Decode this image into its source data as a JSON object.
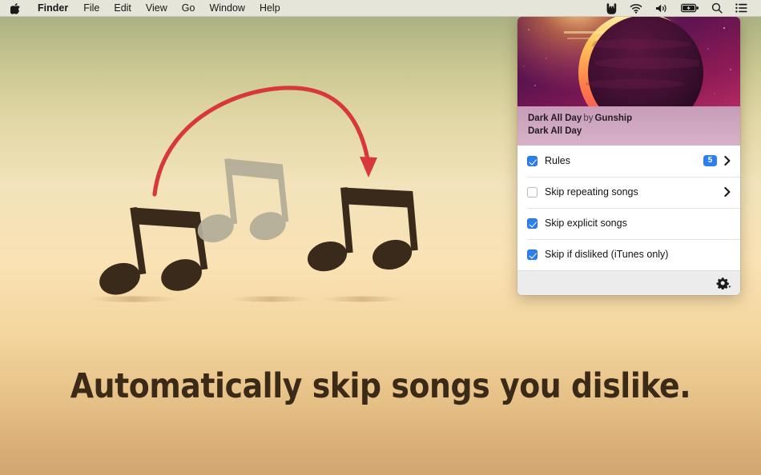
{
  "menubar": {
    "apple_icon": "apple-logo-icon",
    "items": [
      {
        "label": "Finder",
        "bold": true
      },
      {
        "label": "File",
        "bold": false
      },
      {
        "label": "Edit",
        "bold": false
      },
      {
        "label": "View",
        "bold": false
      },
      {
        "label": "Go",
        "bold": false
      },
      {
        "label": "Window",
        "bold": false
      },
      {
        "label": "Help",
        "bold": false
      }
    ],
    "status_icons": [
      {
        "name": "hand-horns-icon"
      },
      {
        "name": "wifi-icon"
      },
      {
        "name": "volume-icon"
      },
      {
        "name": "battery-charging-icon"
      },
      {
        "name": "search-icon"
      },
      {
        "name": "control-center-icon"
      }
    ]
  },
  "panel": {
    "artwork_name": "album-artwork-eclipse",
    "track": {
      "title": "Dark All Day",
      "by_word": "by",
      "artist": "Gunship",
      "album": "Dark All Day"
    },
    "rows": [
      {
        "label": "Rules",
        "checked": true,
        "badge": "5",
        "chevron": true
      },
      {
        "label": "Skip repeating songs",
        "checked": false,
        "badge": null,
        "chevron": true
      },
      {
        "label": "Skip explicit songs",
        "checked": true,
        "badge": null,
        "chevron": false
      },
      {
        "label": "Skip if disliked (iTunes only)",
        "checked": true,
        "badge": null,
        "chevron": false
      }
    ],
    "footer": {
      "gear_icon": "gear-dropdown-icon"
    }
  },
  "desktop": {
    "tagline": "Automatically skip songs you dislike.",
    "illustration_name": "three-music-notes-with-skip-arrow"
  },
  "colors": {
    "accent_blue": "#2d7ff0",
    "arrow_red": "#d6383c",
    "note_dark": "#3a2a1c",
    "note_muted": "#b0aa95",
    "tagline_color": "#3c2a19",
    "menubar_bg": "#eaebe0",
    "trackinfo_bg": "#cfa7c0"
  }
}
